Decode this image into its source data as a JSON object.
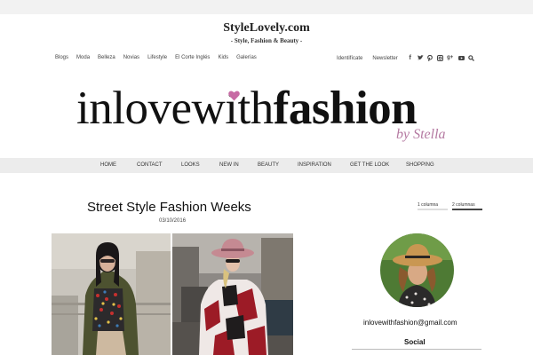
{
  "header": {
    "site_logo": "StyleLovely.com",
    "tagline": "- Style, Fashion & Beauty -"
  },
  "top_nav": {
    "items": [
      "Blogs",
      "Moda",
      "Belleza",
      "Novias",
      "Lifestyle",
      "El Corte Inglés",
      "Kids",
      "Galerías"
    ],
    "identify": "Identifícate",
    "newsletter": "Newsletter",
    "icons": [
      "facebook-icon",
      "twitter-icon",
      "pinterest-icon",
      "instagram-icon",
      "google-plus-icon",
      "youtube-icon",
      "search-icon"
    ]
  },
  "banner": {
    "title_light": "inlovewith",
    "title_bold": "fashion",
    "byline": "by Stella",
    "heart_color": "#c76aa4"
  },
  "main_nav": {
    "items": [
      "HOME",
      "CONTACT",
      "LOOKS",
      "NEW IN",
      "BEAUTY",
      "INSPIRATION",
      "GET THE LOOK",
      "SHOPPING"
    ]
  },
  "post": {
    "title": "Street Style Fashion Weeks",
    "date": "03/10/2016"
  },
  "layout_toggle": {
    "one_column": "1 columna",
    "two_columns": "2 columnas",
    "active": "2 columnas"
  },
  "sidebar": {
    "email": "inlovewithfashion@gmail.com",
    "social_heading": "Social"
  }
}
